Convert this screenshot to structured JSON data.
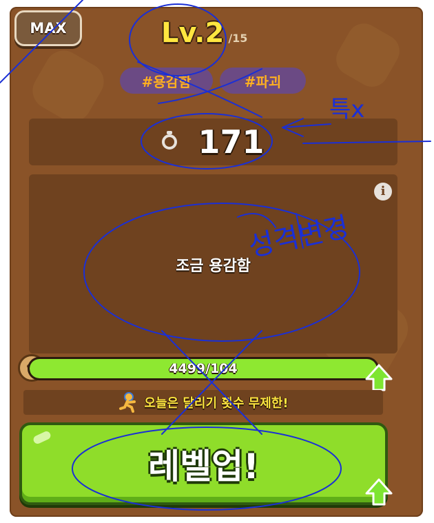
{
  "header": {
    "max_button": "MAX",
    "level": "Lv.2",
    "level_max": "/15"
  },
  "tags": [
    "#용감함",
    "#파괴"
  ],
  "stat": {
    "icon": "potion-icon",
    "value": "171"
  },
  "description": {
    "text": "조금 용감함",
    "info_icon": "info-icon"
  },
  "experience": {
    "text": "4499/104",
    "progress": 1.0
  },
  "notice": {
    "text": "오늘은 달리기 횟수 무제한!"
  },
  "action": {
    "levelup_label": "레벨업!"
  },
  "handwriting": {
    "note_top": "특x",
    "note_middle": "성격변경"
  },
  "colors": {
    "panel": "#8a5328",
    "inner_box": "#6f421f",
    "accent_yellow": "#ffe640",
    "tag_bg": "#6b4a84",
    "tag_text": "#ffb020",
    "button_green": "#8fdd2a",
    "annotation_blue": "#1a2fd6"
  }
}
